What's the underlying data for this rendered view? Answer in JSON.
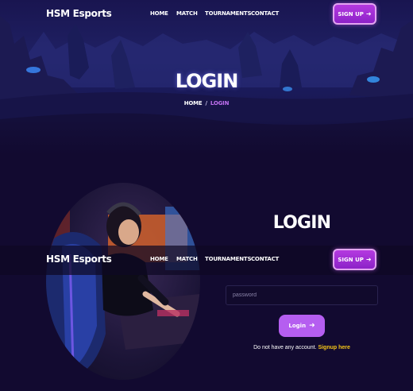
{
  "header": {
    "brand": "HSM Esports",
    "nav": [
      {
        "label": "HOME"
      },
      {
        "label": "MATCH"
      },
      {
        "label": "TOURNAMENTS"
      },
      {
        "label": "CONTACT"
      }
    ],
    "signup_label": "SIGN UP",
    "signup_icon": "arrow-right-icon"
  },
  "hero": {
    "title": "LOGIN",
    "breadcrumb": {
      "home": "HOME",
      "separator": "/",
      "current": "LOGIN"
    }
  },
  "login": {
    "title": "LOGIN",
    "password_placeholder": "password",
    "password_value": "",
    "button_label": "Login",
    "button_icon": "arrow-right-icon",
    "note_text": "Do not have any account.",
    "signup_link": "Signup here"
  },
  "colors": {
    "background": "#120a30",
    "accent_purple": "#b55ef0",
    "signup_gradient": "#a52ed6",
    "link_yellow": "#f5c518",
    "breadcrumb_active": "#c070f0"
  }
}
